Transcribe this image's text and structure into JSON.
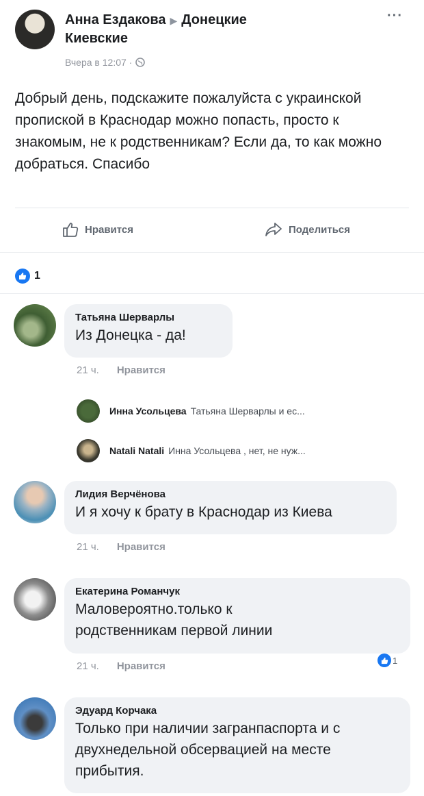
{
  "post": {
    "author": "Анна Ездакова",
    "group_line1": "Донецкие",
    "group_line2": "Киевские",
    "time": "Вчера в 12:07 ·",
    "more": "···",
    "text": "Добрый день, подскажите пожалуйста с украинской пропиской в Краснодар можно попасть, просто к знакомым, не к родственникам? Если да, то как можно добраться. Спасибо",
    "like_label": "Нравится",
    "share_label": "Поделиться",
    "reaction_count": "1"
  },
  "comments": [
    {
      "name": "Татьяна Шерварлы",
      "text": "Из Донецка - да!",
      "time": "21 ч.",
      "like": "Нравится"
    },
    {
      "name": "Лидия Верчёнова",
      "text": "И я хочу к брату в Краснодар из Киева",
      "time": "21 ч.",
      "like": "Нравится"
    },
    {
      "name": "Екатерина Романчук",
      "text": "Маловероятно.только к родственникам первой линии",
      "time": "21 ч.",
      "like": "Нравится",
      "reactions": "1"
    },
    {
      "name": "Эдуард Корчака",
      "text": "Только при наличии загранпаспорта и с двухнедельной обсервацией на месте прибытия."
    }
  ],
  "replies": [
    {
      "name": "Инна Усольцева",
      "text": "Татьяна Шерварлы и ес..."
    },
    {
      "name": "Natali Natali",
      "text": "Инна Усольцева , нет, не нуж..."
    }
  ],
  "colors": {
    "accent": "#1877f2",
    "bubble": "#f0f2f5"
  }
}
